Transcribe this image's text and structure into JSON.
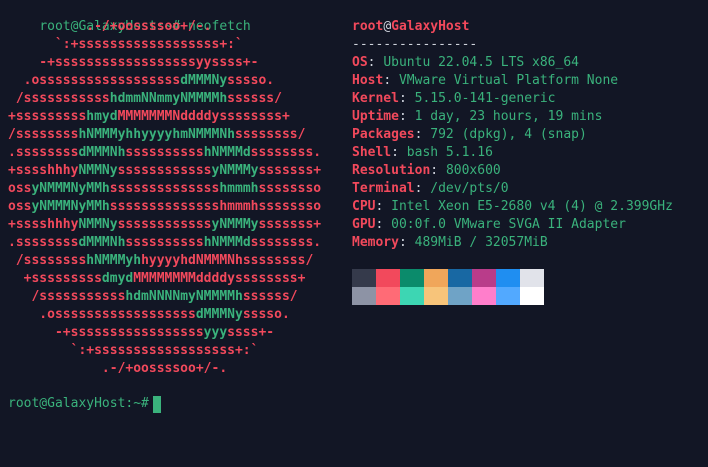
{
  "top_prompt": {
    "user_host": "root@GalaxyHost",
    "path": ":~#",
    "command": "neofetch"
  },
  "logo_rows": [
    [
      [
        "r",
        "          .-/+oossssoo+/-.               "
      ]
    ],
    [
      [
        "r",
        "      `:+ssssssssssssssssss+:`           "
      ]
    ],
    [
      [
        "r",
        "    -+ssssssssssssssssssyyssss+-         "
      ]
    ],
    [
      [
        "r",
        "  .ossssssssssssssssss"
      ],
      [
        "g",
        "dMMMNy"
      ],
      [
        "r",
        "sssso.       "
      ]
    ],
    [
      [
        "r",
        " /sssssssssss"
      ],
      [
        "g",
        "hdmmNNmmyNMMMMh"
      ],
      [
        "r",
        "ssssss/      "
      ]
    ],
    [
      [
        "r",
        "+sssssssss"
      ],
      [
        "g",
        "hmyd"
      ],
      [
        "r",
        "MMMMMMMNddddy"
      ],
      [
        "r",
        "ssssssss+     "
      ]
    ],
    [
      [
        "r",
        "/ssssssss"
      ],
      [
        "g",
        "hNMMMyhhyyyyhmNMMMNh"
      ],
      [
        "r",
        "ssssssss/    "
      ]
    ],
    [
      [
        "r",
        ".ssssssss"
      ],
      [
        "g",
        "dMMMNh"
      ],
      [
        "r",
        "ssssssssss"
      ],
      [
        "g",
        "hNMMMd"
      ],
      [
        "r",
        "ssssssss.   "
      ]
    ],
    [
      [
        "r",
        "+sssshhhy"
      ],
      [
        "g",
        "NMMNy"
      ],
      [
        "r",
        "ssssssssssss"
      ],
      [
        "g",
        "yNMMMy"
      ],
      [
        "r",
        "sssssss+   "
      ]
    ],
    [
      [
        "r",
        "oss"
      ],
      [
        "g",
        "yNMMMNyMMh"
      ],
      [
        "r",
        "ssssssssssssss"
      ],
      [
        "g",
        "hmmmh"
      ],
      [
        "r",
        "ssssssso   "
      ]
    ],
    [
      [
        "r",
        "oss"
      ],
      [
        "g",
        "yNMMMNyMMh"
      ],
      [
        "r",
        "sssssssssssssshmmmh"
      ],
      [
        "r",
        "ssssssso   "
      ]
    ],
    [
      [
        "r",
        "+sssshhhy"
      ],
      [
        "g",
        "NMMNy"
      ],
      [
        "r",
        "ssssssssssss"
      ],
      [
        "g",
        "yNMMMy"
      ],
      [
        "r",
        "sssssss+   "
      ]
    ],
    [
      [
        "r",
        ".ssssssss"
      ],
      [
        "g",
        "dMMMNh"
      ],
      [
        "r",
        "ssssssssss"
      ],
      [
        "g",
        "hNMMMd"
      ],
      [
        "r",
        "ssssssss.   "
      ]
    ],
    [
      [
        "r",
        " /ssssssss"
      ],
      [
        "g",
        "hNMMMyh"
      ],
      [
        "r",
        "hyyyyhdNMMMNh"
      ],
      [
        "r",
        "ssssssss/  "
      ]
    ],
    [
      [
        "r",
        "  +sssssssss"
      ],
      [
        "g",
        "dmyd"
      ],
      [
        "r",
        "MMMMMMMMddddy"
      ],
      [
        "r",
        "ssssssss+   "
      ]
    ],
    [
      [
        "r",
        "   /sssssssssss"
      ],
      [
        "g",
        "hdmNNNNmyNMMMMh"
      ],
      [
        "r",
        "ssssss/     "
      ]
    ],
    [
      [
        "r",
        "    .ossssssssssssssssss"
      ],
      [
        "g",
        "dMMMNy"
      ],
      [
        "r",
        "sssso.      "
      ]
    ],
    [
      [
        "r",
        "      -+sssssssssssssssss"
      ],
      [
        "g",
        "yyy"
      ],
      [
        "r",
        "ssss+-        "
      ]
    ],
    [
      [
        "r",
        "        `:+ssssssssssssssssss+:`         "
      ]
    ],
    [
      [
        "r",
        "            .-/+oossssoo+/-.             "
      ]
    ]
  ],
  "info": {
    "header_user": "root",
    "header_at": "@",
    "header_host": "GalaxyHost",
    "separator": "----------------",
    "rows": [
      {
        "key": "OS",
        "value": "Ubuntu 22.04.5 LTS x86_64"
      },
      {
        "key": "Host",
        "value": "VMware Virtual Platform None"
      },
      {
        "key": "Kernel",
        "value": "5.15.0-141-generic"
      },
      {
        "key": "Uptime",
        "value": "1 day, 23 hours, 19 mins"
      },
      {
        "key": "Packages",
        "value": "792 (dpkg), 4 (snap)"
      },
      {
        "key": "Shell",
        "value": "bash 5.1.16"
      },
      {
        "key": "Resolution",
        "value": "800x600"
      },
      {
        "key": "Terminal",
        "value": "/dev/pts/0"
      },
      {
        "key": "CPU",
        "value": "Intel Xeon E5-2680 v4 (4) @ 2.399GHz"
      },
      {
        "key": "GPU",
        "value": "00:0f.0 VMware SVGA II Adapter"
      },
      {
        "key": "Memory",
        "value": "489MiB / 32057MiB"
      }
    ]
  },
  "palette": {
    "normal": [
      "#353a4b",
      "#f2495c",
      "#0b8b6b",
      "#f0a65a",
      "#1868a3",
      "#b93c8a",
      "#1f8ef1",
      "#e1e3ea"
    ],
    "bright": [
      "#8d93a5",
      "#ff6b76",
      "#3dd6b3",
      "#f7c47a",
      "#6fa3c6",
      "#ff7ecb",
      "#52a9ff",
      "#ffffff"
    ]
  },
  "bottom_prompt": {
    "user_host": "root@GalaxyHost",
    "path": ":~#"
  },
  "colors": {
    "background": "#121625",
    "red": "#f2495c",
    "green": "#3ab27c",
    "foreground": "#cfd3dc"
  }
}
